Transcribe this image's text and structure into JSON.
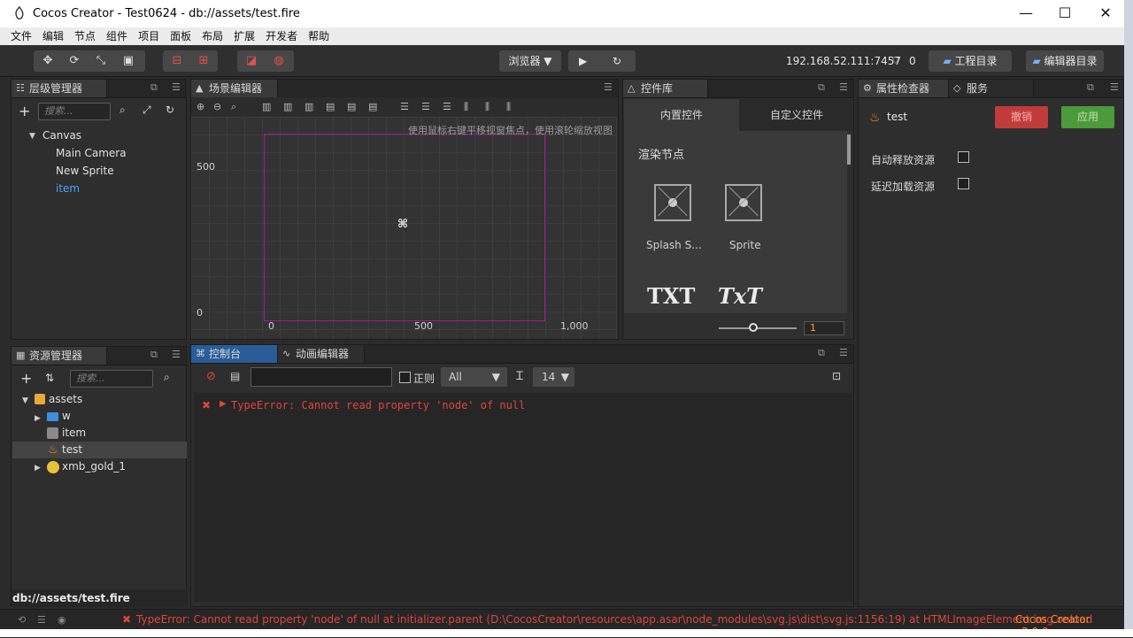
{
  "window": {
    "title": "Cocos Creator - Test0624 - db://assets/test.fire",
    "minimize": "—",
    "maximize": "☐",
    "close": "✕"
  },
  "menu": [
    "文件",
    "编辑",
    "节点",
    "组件",
    "项目",
    "面板",
    "布局",
    "扩展",
    "开发者",
    "帮助"
  ],
  "toolbar": {
    "browser_label": "浏览器",
    "play_icon": "▶",
    "refresh_icon": "↻",
    "ip_address": "192.168.52.111:7457",
    "connections": "0",
    "project_dir": "工程目录",
    "editor_dir": "编辑器目录"
  },
  "hierarchy": {
    "tab": "层级管理器",
    "search_placeholder": "搜索...",
    "nodes": {
      "root": "Canvas",
      "child1": "Main Camera",
      "child2": "New Sprite",
      "child3": "item"
    }
  },
  "scene": {
    "tab": "场景编辑器",
    "hint": "使用鼠标右键平移视窗焦点，使用滚轮缩放视图",
    "y_labels": {
      "top": "500",
      "bottom": "0"
    },
    "x_labels": {
      "a": "0",
      "b": "500",
      "c": "1,000"
    }
  },
  "widgets": {
    "tab": "控件库",
    "builtin_tab": "内置控件",
    "custom_tab": "自定义控件",
    "section": "渲染节点",
    "items": {
      "a": "Splash S...",
      "b": "Sprite"
    },
    "txt1": "TXT",
    "txt2": "TxT",
    "zoom_value": "1"
  },
  "inspector": {
    "tab": "属性检查器",
    "services_tab": "服务",
    "asset_name": "test",
    "revert": "撤销",
    "apply": "应用",
    "auto_release": "自动释放资源",
    "lazy_load": "延迟加载资源"
  },
  "assets": {
    "tab": "资源管理器",
    "search_placeholder": "搜索...",
    "root": "assets",
    "items": {
      "w": "w",
      "item": "item",
      "test": "test",
      "gold": "xmb_gold_1"
    },
    "path": "db://assets/test.fire"
  },
  "console": {
    "tab": "控制台",
    "anim_tab": "动画编辑器",
    "regex": "正则",
    "filter": "All",
    "font_size": "14",
    "error": "TypeError: Cannot read property 'node' of null"
  },
  "status": {
    "error": "TypeError: Cannot read property 'node' of null at initializer.parent (D:\\CocosCreator\\resources\\app.asar\\node_modules\\svg.js\\dist\\svg.js:1156:19) at HTMLImageElement.img.onload",
    "version": "Cocos Creator v2.0.9"
  },
  "colors": {
    "accent": "#4aa3ff",
    "error": "#e0453b",
    "revert": "#c23b3b",
    "apply": "#4d9a3b",
    "selection_frame": "#a1199c"
  }
}
